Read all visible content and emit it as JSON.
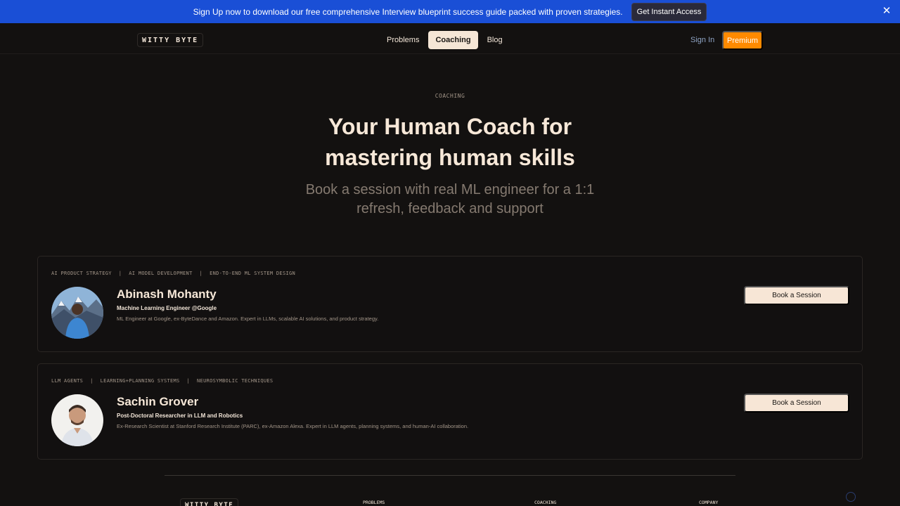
{
  "banner": {
    "text": "Sign Up now to download our free comprehensive Interview blueprint success guide packed with proven strategies.",
    "cta_label": "Get Instant Access",
    "close_icon": "close-icon"
  },
  "header": {
    "logo": "WITTY BYTE",
    "nav": [
      {
        "label": "Problems"
      },
      {
        "label": "Coaching"
      },
      {
        "label": "Blog"
      }
    ],
    "signin_label": "Sign In",
    "premium_label": "Premium"
  },
  "hero": {
    "eyebrow": "COACHING",
    "title_line1": "Your Human Coach for",
    "title_line2": "mastering human skills",
    "subtitle_line1": "Book a session with real ML engineer for a 1:1",
    "subtitle_line2": "refresh, feedback and support"
  },
  "coaches": [
    {
      "tags": [
        "AI PRODUCT STRATEGY",
        "AI MODEL DEVELOPMENT",
        "END-TO-END ML SYSTEM DESIGN"
      ],
      "name": "Abinash Mohanty",
      "role": "Machine Learning Engineer @Google",
      "bio": "ML Engineer at Google, ex-ByteDance and Amazon. Expert in LLMs, scalable AI solutions, and product strategy.",
      "book_label": "Book a Session"
    },
    {
      "tags": [
        "LLM AGENTS",
        "LEARNING+PLANNING SYSTEMS",
        "NEUROSYMBOLIC TECHNIQUES"
      ],
      "name": "Sachin Grover",
      "role": "Post-Doctoral Researcher in LLM and Robotics",
      "bio": "Ex-Research Scientist at Stanford Research Institute (PARC), ex-Amazon Alexa. Expert in LLM agents, planning systems, and human-AI collaboration.",
      "book_label": "Book a Session"
    }
  ],
  "footer": {
    "logo": "WITTY BYTE",
    "columns": [
      "PROBLEMS",
      "COACHING",
      "COMPANY"
    ]
  },
  "colors": {
    "banner": "#1a4fd6",
    "accent": "#ff8a00",
    "background": "#131110",
    "button_light": "#f7e6d6"
  }
}
